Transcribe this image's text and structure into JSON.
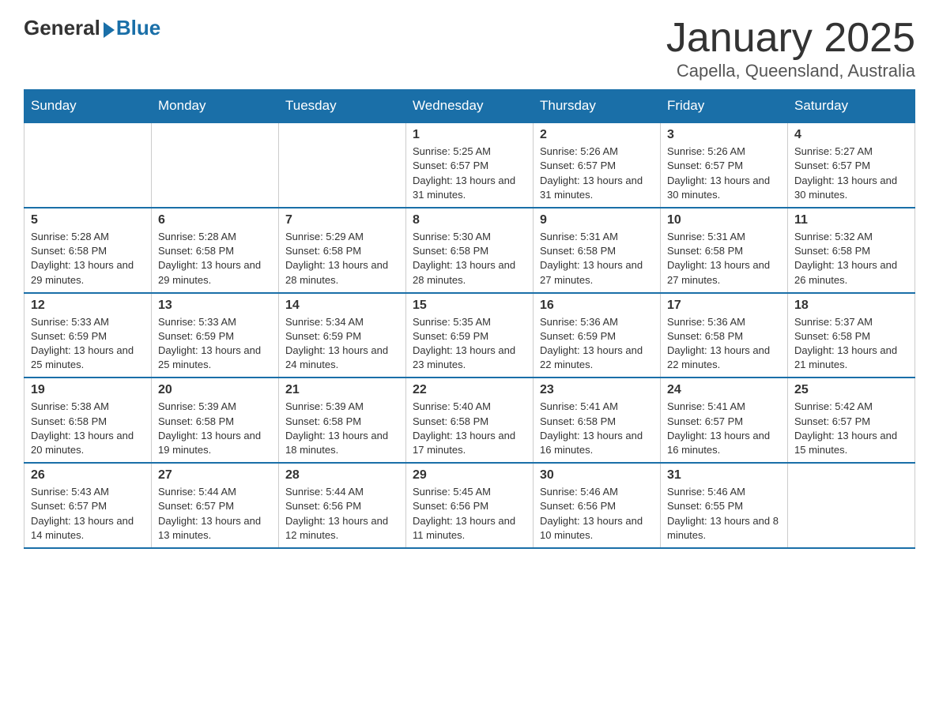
{
  "logo": {
    "general": "General",
    "blue": "Blue"
  },
  "title": "January 2025",
  "subtitle": "Capella, Queensland, Australia",
  "days_of_week": [
    "Sunday",
    "Monday",
    "Tuesday",
    "Wednesday",
    "Thursday",
    "Friday",
    "Saturday"
  ],
  "weeks": [
    [
      {
        "day": "",
        "info": ""
      },
      {
        "day": "",
        "info": ""
      },
      {
        "day": "",
        "info": ""
      },
      {
        "day": "1",
        "info": "Sunrise: 5:25 AM\nSunset: 6:57 PM\nDaylight: 13 hours and 31 minutes."
      },
      {
        "day": "2",
        "info": "Sunrise: 5:26 AM\nSunset: 6:57 PM\nDaylight: 13 hours and 31 minutes."
      },
      {
        "day": "3",
        "info": "Sunrise: 5:26 AM\nSunset: 6:57 PM\nDaylight: 13 hours and 30 minutes."
      },
      {
        "day": "4",
        "info": "Sunrise: 5:27 AM\nSunset: 6:57 PM\nDaylight: 13 hours and 30 minutes."
      }
    ],
    [
      {
        "day": "5",
        "info": "Sunrise: 5:28 AM\nSunset: 6:58 PM\nDaylight: 13 hours and 29 minutes."
      },
      {
        "day": "6",
        "info": "Sunrise: 5:28 AM\nSunset: 6:58 PM\nDaylight: 13 hours and 29 minutes."
      },
      {
        "day": "7",
        "info": "Sunrise: 5:29 AM\nSunset: 6:58 PM\nDaylight: 13 hours and 28 minutes."
      },
      {
        "day": "8",
        "info": "Sunrise: 5:30 AM\nSunset: 6:58 PM\nDaylight: 13 hours and 28 minutes."
      },
      {
        "day": "9",
        "info": "Sunrise: 5:31 AM\nSunset: 6:58 PM\nDaylight: 13 hours and 27 minutes."
      },
      {
        "day": "10",
        "info": "Sunrise: 5:31 AM\nSunset: 6:58 PM\nDaylight: 13 hours and 27 minutes."
      },
      {
        "day": "11",
        "info": "Sunrise: 5:32 AM\nSunset: 6:58 PM\nDaylight: 13 hours and 26 minutes."
      }
    ],
    [
      {
        "day": "12",
        "info": "Sunrise: 5:33 AM\nSunset: 6:59 PM\nDaylight: 13 hours and 25 minutes."
      },
      {
        "day": "13",
        "info": "Sunrise: 5:33 AM\nSunset: 6:59 PM\nDaylight: 13 hours and 25 minutes."
      },
      {
        "day": "14",
        "info": "Sunrise: 5:34 AM\nSunset: 6:59 PM\nDaylight: 13 hours and 24 minutes."
      },
      {
        "day": "15",
        "info": "Sunrise: 5:35 AM\nSunset: 6:59 PM\nDaylight: 13 hours and 23 minutes."
      },
      {
        "day": "16",
        "info": "Sunrise: 5:36 AM\nSunset: 6:59 PM\nDaylight: 13 hours and 22 minutes."
      },
      {
        "day": "17",
        "info": "Sunrise: 5:36 AM\nSunset: 6:58 PM\nDaylight: 13 hours and 22 minutes."
      },
      {
        "day": "18",
        "info": "Sunrise: 5:37 AM\nSunset: 6:58 PM\nDaylight: 13 hours and 21 minutes."
      }
    ],
    [
      {
        "day": "19",
        "info": "Sunrise: 5:38 AM\nSunset: 6:58 PM\nDaylight: 13 hours and 20 minutes."
      },
      {
        "day": "20",
        "info": "Sunrise: 5:39 AM\nSunset: 6:58 PM\nDaylight: 13 hours and 19 minutes."
      },
      {
        "day": "21",
        "info": "Sunrise: 5:39 AM\nSunset: 6:58 PM\nDaylight: 13 hours and 18 minutes."
      },
      {
        "day": "22",
        "info": "Sunrise: 5:40 AM\nSunset: 6:58 PM\nDaylight: 13 hours and 17 minutes."
      },
      {
        "day": "23",
        "info": "Sunrise: 5:41 AM\nSunset: 6:58 PM\nDaylight: 13 hours and 16 minutes."
      },
      {
        "day": "24",
        "info": "Sunrise: 5:41 AM\nSunset: 6:57 PM\nDaylight: 13 hours and 16 minutes."
      },
      {
        "day": "25",
        "info": "Sunrise: 5:42 AM\nSunset: 6:57 PM\nDaylight: 13 hours and 15 minutes."
      }
    ],
    [
      {
        "day": "26",
        "info": "Sunrise: 5:43 AM\nSunset: 6:57 PM\nDaylight: 13 hours and 14 minutes."
      },
      {
        "day": "27",
        "info": "Sunrise: 5:44 AM\nSunset: 6:57 PM\nDaylight: 13 hours and 13 minutes."
      },
      {
        "day": "28",
        "info": "Sunrise: 5:44 AM\nSunset: 6:56 PM\nDaylight: 13 hours and 12 minutes."
      },
      {
        "day": "29",
        "info": "Sunrise: 5:45 AM\nSunset: 6:56 PM\nDaylight: 13 hours and 11 minutes."
      },
      {
        "day": "30",
        "info": "Sunrise: 5:46 AM\nSunset: 6:56 PM\nDaylight: 13 hours and 10 minutes."
      },
      {
        "day": "31",
        "info": "Sunrise: 5:46 AM\nSunset: 6:55 PM\nDaylight: 13 hours and 8 minutes."
      },
      {
        "day": "",
        "info": ""
      }
    ]
  ]
}
